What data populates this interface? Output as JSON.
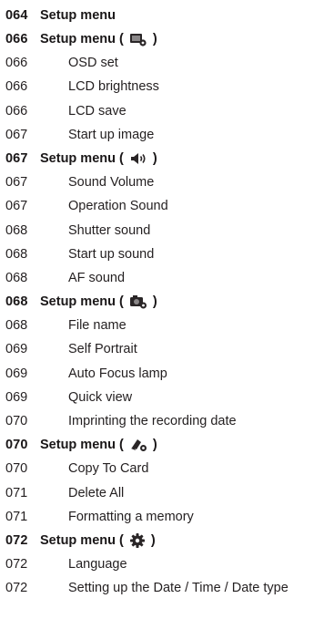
{
  "entries": [
    {
      "page": "064",
      "title": "Setup menu",
      "kind": "head"
    },
    {
      "page": "066",
      "title": "Setup menu (",
      "close": ")",
      "kind": "head",
      "icon": "display-settings-icon"
    },
    {
      "page": "066",
      "title": "OSD set",
      "kind": "sub"
    },
    {
      "page": "066",
      "title": "LCD brightness",
      "kind": "sub"
    },
    {
      "page": "066",
      "title": "LCD save",
      "kind": "sub"
    },
    {
      "page": "067",
      "title": "Start up image",
      "kind": "sub"
    },
    {
      "page": "067",
      "title": "Setup menu (",
      "close": ")",
      "kind": "head",
      "icon": "speaker-icon"
    },
    {
      "page": "067",
      "title": "Sound Volume",
      "kind": "sub"
    },
    {
      "page": "067",
      "title": "Operation Sound",
      "kind": "sub"
    },
    {
      "page": "068",
      "title": "Shutter sound",
      "kind": "sub"
    },
    {
      "page": "068",
      "title": "Start up sound",
      "kind": "sub"
    },
    {
      "page": "068",
      "title": "AF sound",
      "kind": "sub"
    },
    {
      "page": "068",
      "title": "Setup menu (",
      "close": ")",
      "kind": "head",
      "icon": "camera-settings-icon"
    },
    {
      "page": "068",
      "title": "File name",
      "kind": "sub"
    },
    {
      "page": "069",
      "title": "Self Portrait",
      "kind": "sub"
    },
    {
      "page": "069",
      "title": "Auto Focus lamp",
      "kind": "sub"
    },
    {
      "page": "069",
      "title": "Quick view",
      "kind": "sub"
    },
    {
      "page": "070",
      "title": "Imprinting the recording date",
      "kind": "sub"
    },
    {
      "page": "070",
      "title": "Setup menu (",
      "close": ")",
      "kind": "head",
      "icon": "memory-settings-icon"
    },
    {
      "page": "070",
      "title": "Copy To Card",
      "kind": "sub"
    },
    {
      "page": "071",
      "title": "Delete All",
      "kind": "sub"
    },
    {
      "page": "071",
      "title": "Formatting a memory",
      "kind": "sub"
    },
    {
      "page": "072",
      "title": "Setup menu (",
      "close": ")",
      "kind": "head",
      "icon": "gear-icon"
    },
    {
      "page": "072",
      "title": "Language",
      "kind": "sub"
    },
    {
      "page": "072",
      "title": "Setting up the Date / Time / Date type",
      "kind": "sub"
    }
  ]
}
